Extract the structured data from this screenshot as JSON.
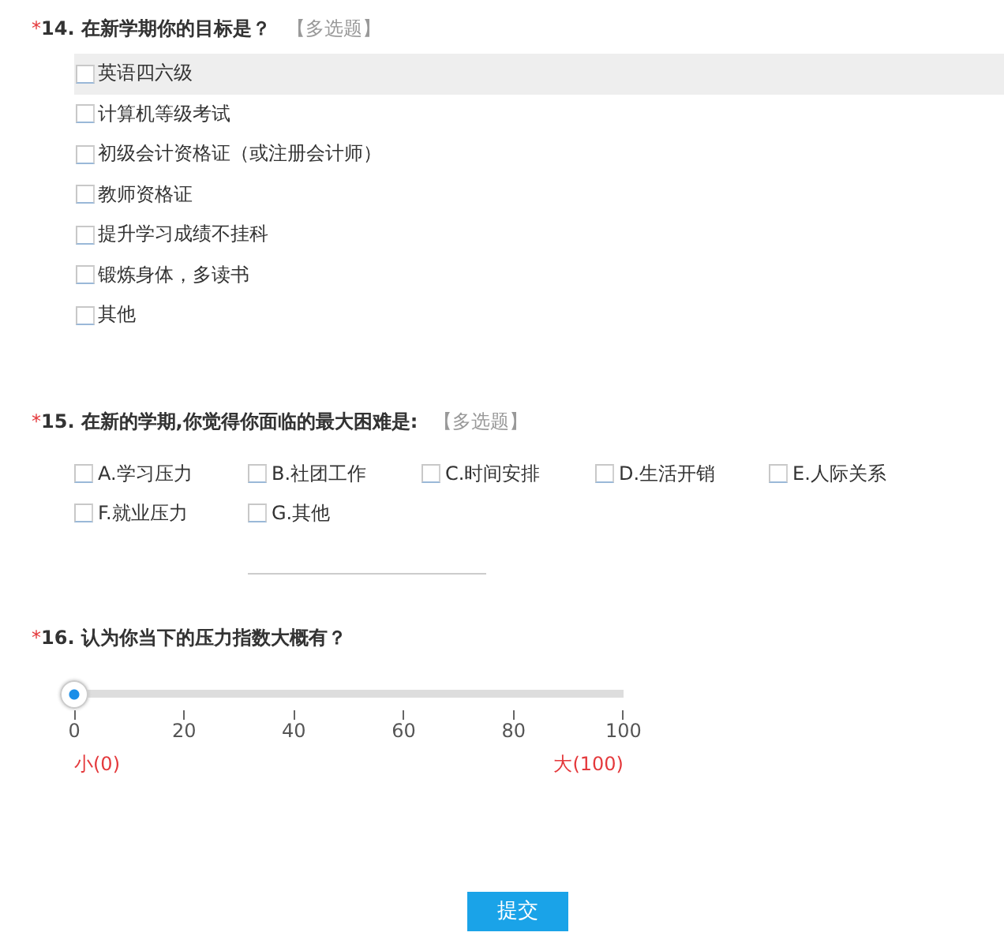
{
  "questions": [
    {
      "kind": "checklist",
      "required_mark": "*",
      "number": "14.",
      "title": "在新学期你的目标是？",
      "tag": "【多选题】",
      "options": [
        {
          "label": "英语四六级",
          "checked": false,
          "hovered": true
        },
        {
          "label": "计算机等级考试",
          "checked": false,
          "hovered": false
        },
        {
          "label": "初级会计资格证（或注册会计师）",
          "checked": false,
          "hovered": false
        },
        {
          "label": "教师资格证",
          "checked": false,
          "hovered": false
        },
        {
          "label": "提升学习成绩不挂科",
          "checked": false,
          "hovered": false
        },
        {
          "label": "锻炼身体，多读书",
          "checked": false,
          "hovered": false
        },
        {
          "label": "其他",
          "checked": false,
          "hovered": false
        }
      ]
    },
    {
      "kind": "grid",
      "required_mark": "*",
      "number": "15.",
      "title": "在新的学期,你觉得你面临的最大困难是:",
      "tag": "【多选题】",
      "options": [
        {
          "label": "A.学习压力",
          "checked": false
        },
        {
          "label": "B.社团工作",
          "checked": false
        },
        {
          "label": "C.时间安排",
          "checked": false
        },
        {
          "label": "D.生活开销",
          "checked": false
        },
        {
          "label": "E.人际关系",
          "checked": false
        },
        {
          "label": "F.就业压力",
          "checked": false
        },
        {
          "label": "G.其他",
          "checked": false,
          "fill_in": true
        }
      ]
    },
    {
      "kind": "slider",
      "required_mark": "*",
      "number": "16.",
      "title": "认为你当下的压力指数大概有？",
      "level": 0,
      "ticks": [
        "0",
        "20",
        "40",
        "60",
        "80",
        "100"
      ],
      "min_label": "小(0)",
      "max_label": "大(100)"
    }
  ],
  "submit": "提交"
}
